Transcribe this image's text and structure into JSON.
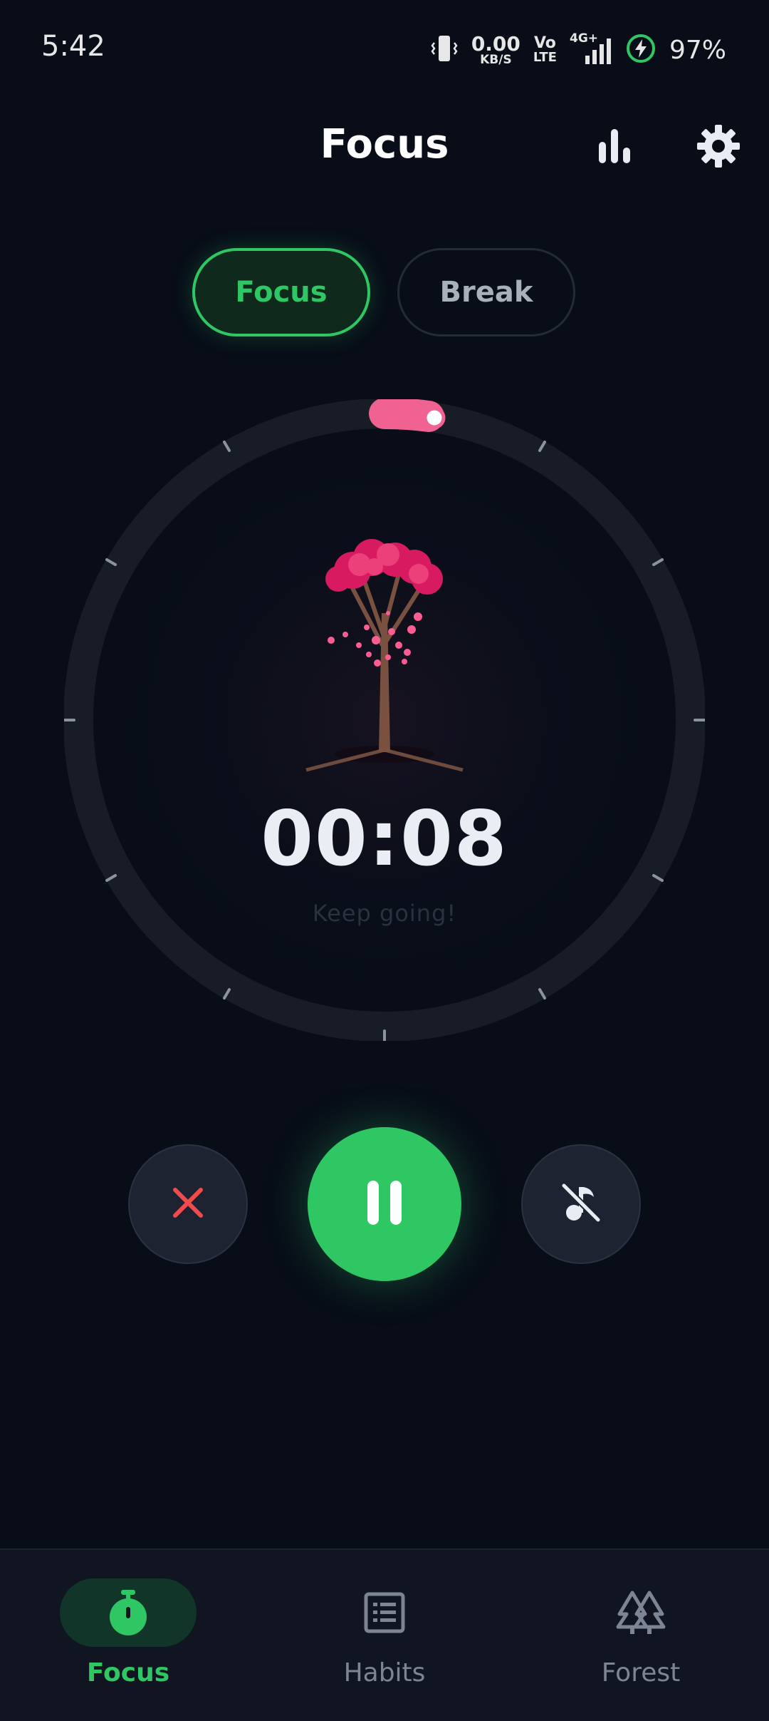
{
  "status_bar": {
    "time": "5:42",
    "net_speed_value": "0.00",
    "net_speed_unit": "KB/S",
    "volte_top": "Vo",
    "volte_bottom": "LTE",
    "network": "4G+",
    "battery": "97%"
  },
  "header": {
    "title": "Focus",
    "stats_icon": "bar-chart-icon",
    "settings_icon": "gear-icon"
  },
  "mode_tabs": [
    {
      "label": "Focus",
      "selected": true
    },
    {
      "label": "Break",
      "selected": false
    }
  ],
  "timer": {
    "display": "00:08",
    "message": "Keep going!",
    "tree_icon": "blossom-tree-icon"
  },
  "controls": {
    "stop_icon": "close-icon",
    "pause_icon": "pause-icon",
    "music_icon": "music-off-icon"
  },
  "bottom_nav": [
    {
      "label": "Focus",
      "icon": "stopwatch-icon",
      "active": true
    },
    {
      "label": "Habits",
      "icon": "list-icon",
      "active": false
    },
    {
      "label": "Forest",
      "icon": "trees-icon",
      "active": false
    }
  ],
  "colors": {
    "background": "#080d18",
    "accent": "#2ec764",
    "progress": "#f06292",
    "stop": "#f04a4a"
  }
}
